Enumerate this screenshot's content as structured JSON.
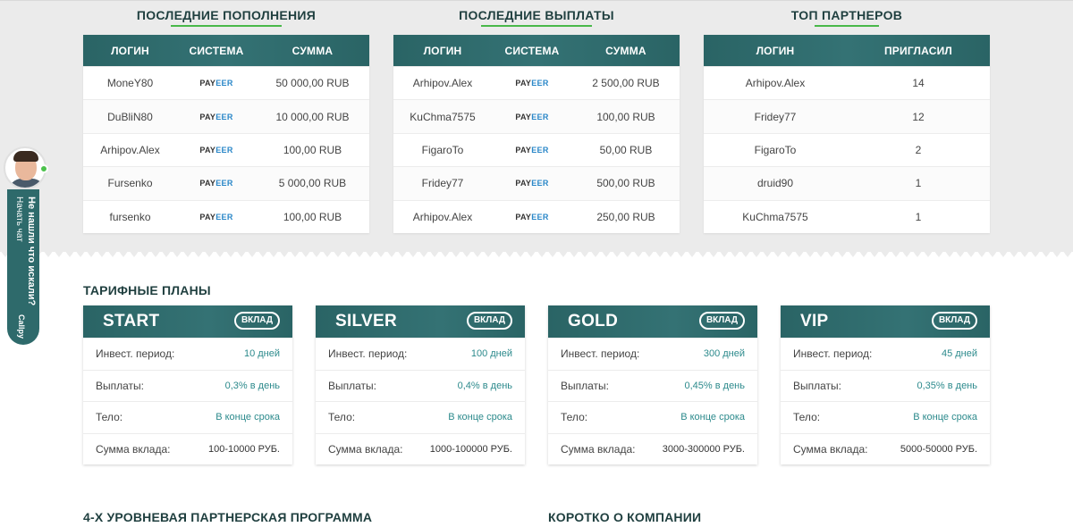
{
  "deposits": {
    "title": "ПОСЛЕДНИЕ ПОПОЛНЕНИЯ",
    "headers": [
      "ЛОГИН",
      "СИСТЕМА",
      "СУММА"
    ],
    "rows": [
      {
        "login": "MoneY80",
        "system_a": "PAY",
        "system_b": "EER",
        "amount": "50 000,00 RUB"
      },
      {
        "login": "DuBliN80",
        "system_a": "PAY",
        "system_b": "EER",
        "amount": "10 000,00 RUB"
      },
      {
        "login": "Arhipov.Alex",
        "system_a": "PAY",
        "system_b": "EER",
        "amount": "100,00 RUB"
      },
      {
        "login": "Fursenko",
        "system_a": "PAY",
        "system_b": "EER",
        "amount": "5 000,00 RUB"
      },
      {
        "login": "fursenko",
        "system_a": "PAY",
        "system_b": "EER",
        "amount": "100,00 RUB"
      }
    ]
  },
  "payouts": {
    "title": "ПОСЛЕДНИЕ ВЫПЛАТЫ",
    "headers": [
      "ЛОГИН",
      "СИСТЕМА",
      "СУММА"
    ],
    "rows": [
      {
        "login": "Arhipov.Alex",
        "system_a": "PAY",
        "system_b": "EER",
        "amount": "2 500,00 RUB"
      },
      {
        "login": "KuChma7575",
        "system_a": "PAY",
        "system_b": "EER",
        "amount": "100,00 RUB"
      },
      {
        "login": "FigaroTo",
        "system_a": "PAY",
        "system_b": "EER",
        "amount": "50,00 RUB"
      },
      {
        "login": "Fridey77",
        "system_a": "PAY",
        "system_b": "EER",
        "amount": "500,00 RUB"
      },
      {
        "login": "Arhipov.Alex",
        "system_a": "PAY",
        "system_b": "EER",
        "amount": "250,00 RUB"
      }
    ]
  },
  "partners": {
    "title": "ТОП ПАРТНЕРОВ",
    "headers": [
      "ЛОГИН",
      "ПРИГЛАСИЛ"
    ],
    "rows": [
      {
        "login": "Arhipov.Alex",
        "invited": "14"
      },
      {
        "login": "Fridey77",
        "invited": "12"
      },
      {
        "login": "FigaroTo",
        "invited": "2"
      },
      {
        "login": "druid90",
        "invited": "1"
      },
      {
        "login": "KuChma7575",
        "invited": "1"
      }
    ]
  },
  "chat": {
    "line1": "Не нашли что искали?",
    "line2": "Начать чат",
    "brand": "Callpy"
  },
  "tariffs": {
    "title": "ТАРИФНЫЕ ПЛАНЫ",
    "button_label": "ВКЛАД",
    "labels": {
      "period": "Инвест. период:",
      "payouts": "Выплаты:",
      "body": "Тело:",
      "amount": "Сумма вклада:"
    },
    "plans": [
      {
        "name": "START",
        "period": "10 дней",
        "payouts": "0,3% в день",
        "body": "В конце срока",
        "amount": "100-10000 РУБ."
      },
      {
        "name": "SILVER",
        "period": "100 дней",
        "payouts": "0,4% в день",
        "body": "В конце срока",
        "amount": "1000-100000 РУБ."
      },
      {
        "name": "GOLD",
        "period": "300 дней",
        "payouts": "0,45% в день",
        "body": "В конце срока",
        "amount": "3000-300000 РУБ."
      },
      {
        "name": "VIP",
        "period": "45 дней",
        "payouts": "0,35% в день",
        "body": "В конце срока",
        "amount": "5000-50000 РУБ."
      }
    ]
  },
  "footer_sections": {
    "partner_program": "4-Х УРОВНЕВАЯ ПАРТНЕРСКАЯ ПРОГРАММА",
    "about": "КОРОТКО О КОМПАНИИ"
  },
  "colors": {
    "accent": "#2e6a6b",
    "underline": "#49b84a",
    "value_text": "#2c8a8c"
  }
}
